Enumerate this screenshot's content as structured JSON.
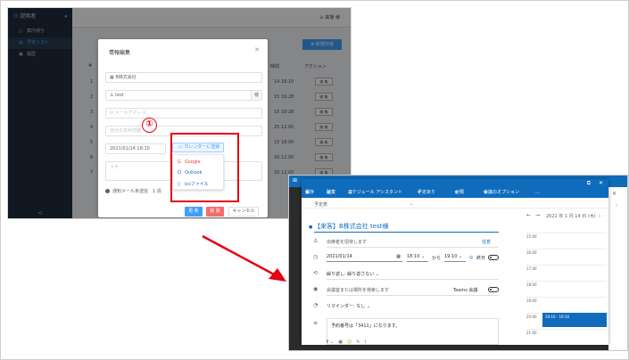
{
  "left_app": {
    "sidebar": {
      "header": "説明者",
      "items": [
        {
          "label": "案内待ち",
          "icon": "person-icon"
        },
        {
          "label": "予定リスト",
          "icon": "list-icon"
        },
        {
          "label": "履歴",
          "icon": "history-icon"
        }
      ],
      "collapse": "<"
    },
    "topbar": {
      "user": "来場 様"
    },
    "new_button": "新規作成",
    "table": {
      "headers": {
        "hash": "#",
        "time": "時間",
        "action": "アクション"
      },
      "rows": [
        {
          "n": "1",
          "time": "14 18:10",
          "action": "編 集"
        },
        {
          "n": "2",
          "time": "15 16:28",
          "action": "編 集"
        },
        {
          "n": "3",
          "time": "15 18:28",
          "action": "編 集"
        },
        {
          "n": "4",
          "time": "25 12:00",
          "action": "編 集"
        },
        {
          "n": "5",
          "time": "15 18:00",
          "action": "編 集"
        },
        {
          "n": "6",
          "time": "20 12:00",
          "action": "編 集"
        },
        {
          "n": "7",
          "time": "20 12:00",
          "action": "編 集"
        }
      ]
    },
    "dialog": {
      "title": "情報編集",
      "company": "B株式会社",
      "name": "test",
      "name_suffix": "様",
      "email_placeholder": "メールアドレス",
      "other_placeholder": "自分の本命詳細",
      "datetime": "2021/01/14 18:10",
      "memo_placeholder": "メモ",
      "notify_label": "通知メール未送信",
      "notify_extra": "1 週",
      "buttons": {
        "update": "更 新",
        "delete": "削 除",
        "cancel": "キャンセル"
      }
    },
    "calendar_button": "カレンダーに登録",
    "calendar_menu": [
      {
        "label": "Google",
        "icon": "google-icon",
        "color": "#ea4335"
      },
      {
        "label": "Outlook",
        "icon": "outlook-icon",
        "color": "#0f6cbd"
      },
      {
        "label": "icsファイル",
        "icon": "ics-file-icon",
        "color": "#0f6cbd"
      }
    ],
    "callout_number": "①"
  },
  "outlook": {
    "toolbar": [
      "保存",
      "破棄",
      "スケジュール アシスタント",
      "予定あり",
      "分類",
      "会議のオプション",
      "…"
    ],
    "subtitle": "予定表",
    "event_title": "【来客】B株式会社 test様",
    "attendee_placeholder": "出席者を招待します",
    "optional": "任意",
    "start_date": "2021/01/14",
    "start_time": "18:10",
    "to_label": "から",
    "end_time": "19:10",
    "allday_label": "終日",
    "repeat_label": "繰り返し: 繰り返さない",
    "location_placeholder": "会議室または場所を検索します",
    "teams_label": "Teams 会議",
    "reminder_label": "リマインダー: なし",
    "body_text": "予約番号は「3411」になります。",
    "calendar_header": "2021 年 1 月 14 日 (木)",
    "calendar_hours": [
      "15:00",
      "16:00",
      "17:00",
      "18:00",
      "19:00",
      "20:00",
      "21:00"
    ],
    "event_block": "19:10 - 19:10"
  }
}
